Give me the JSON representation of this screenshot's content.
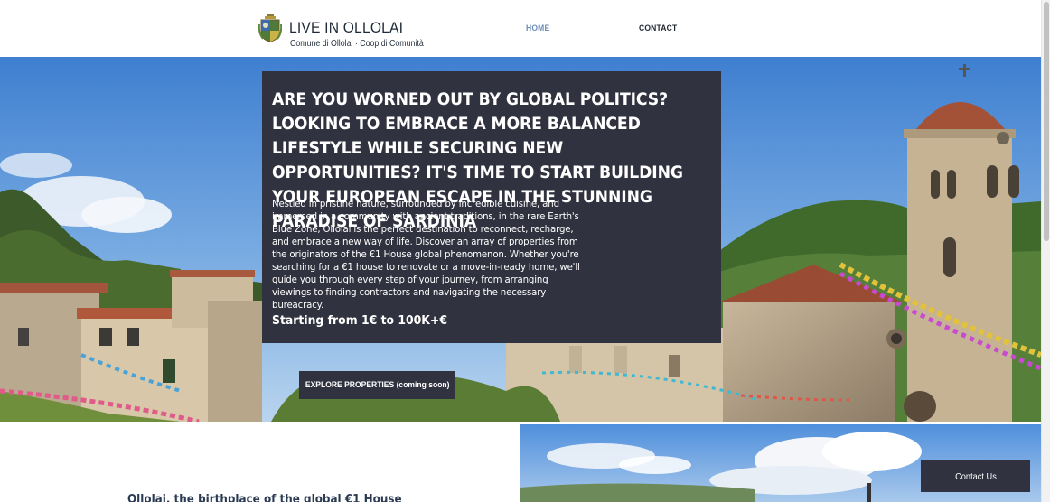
{
  "header": {
    "site_title": "LIVE IN OLLOLAI",
    "site_subtitle": "Comune di Ollolai · Coop di Comunità",
    "nav": [
      {
        "label": "HOME",
        "active": true
      },
      {
        "label": "CONTACT",
        "active": false
      }
    ]
  },
  "hero": {
    "heading": "ARE YOU WORNED OUT BY GLOBAL POLITICS? LOOKING TO EMBRACE A MORE BALANCED LIFESTYLE WHILE SECURING NEW OPPORTUNITIES? IT'S TIME TO START BUILDING YOUR EUROPEAN ESCAPE IN THE STUNNING PARADISE OF SARDINIA",
    "body": "Nestled in pristine nature, surrounded by incredible cuisine, and immersed in a community with ancient traditions, in the rare Earth's Blue Zone, Ollolai is the perfect destination to reconnect, recharge, and embrace a new way of life. Discover an array of properties from the originators of the €1 House global phenomenon. Whether you're searching for a €1 house to renovate or a move-in-ready home, we'll guide you through every step of your journey, from arranging viewings to finding contractors and navigating the necessary bureacracy.",
    "price_line": "Starting from 1€ to 100K+€",
    "cta_label": "EXPLORE PROPERTIES (coming soon)"
  },
  "section2": {
    "title": "Ollolai, the birthplace of the global €1 House"
  },
  "contact_button": {
    "label": "Contact Us"
  },
  "colors": {
    "panel": "#31323f",
    "nav_active": "#6d8db6",
    "text_dark": "#1f2a38"
  },
  "icons": {
    "logo": "coat-of-arms-icon"
  }
}
